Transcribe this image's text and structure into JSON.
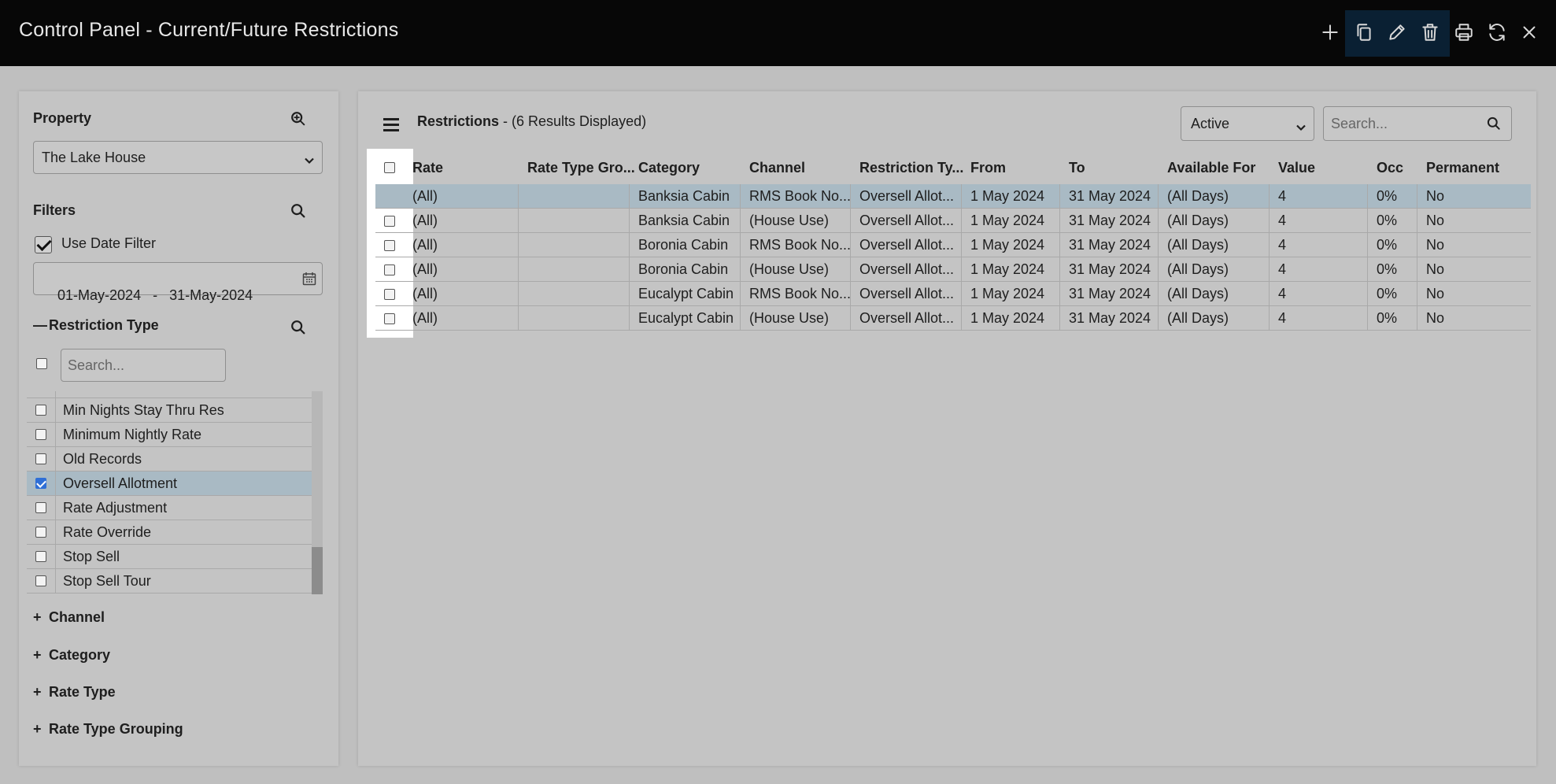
{
  "header": {
    "title": "Control Panel - Current/Future Restrictions",
    "actions": [
      "add-icon",
      "copy-icon",
      "edit-icon",
      "delete-icon",
      "print-icon",
      "refresh-icon",
      "close-icon"
    ]
  },
  "left_panel": {
    "property_label": "Property",
    "property_value": "The Lake House",
    "filters_label": "Filters",
    "use_date_filter_label": "Use Date Filter",
    "use_date_filter_checked": true,
    "date_range": "01-May-2024   -   31-May-2024",
    "restriction_type_label": "Restriction Type",
    "restriction_search_placeholder": "Search...",
    "restriction_items": [
      {
        "label": "Min Nights Stay Thru Res",
        "checked": false
      },
      {
        "label": "Minimum Nightly Rate",
        "checked": false
      },
      {
        "label": "Old Records",
        "checked": false
      },
      {
        "label": "Oversell Allotment",
        "checked": true
      },
      {
        "label": "Rate Adjustment",
        "checked": false
      },
      {
        "label": "Rate Override",
        "checked": false
      },
      {
        "label": "Stop Sell",
        "checked": false
      },
      {
        "label": "Stop Sell Tour",
        "checked": false
      }
    ],
    "collapsed_sections": [
      "Channel",
      "Category",
      "Rate Type",
      "Rate Type Grouping"
    ]
  },
  "main": {
    "title_bold": "Restrictions",
    "title_rest": " - (6 Results Displayed)",
    "status_filter": "Active",
    "search_placeholder": "Search...",
    "columns": [
      "Rate",
      "Rate Type Gro...",
      "Category",
      "Channel",
      "Restriction Ty...",
      "From",
      "To",
      "Available For",
      "Value",
      "Occ",
      "Permanent"
    ],
    "rows": [
      {
        "checked": true,
        "cells": [
          "(All)",
          "",
          "Banksia Cabin",
          "RMS Book No...",
          "Oversell Allot...",
          "1 May 2024",
          "31 May 2024",
          "(All Days)",
          "4",
          "0%",
          "No"
        ]
      },
      {
        "checked": false,
        "cells": [
          "(All)",
          "",
          "Banksia Cabin",
          "(House Use)",
          "Oversell Allot...",
          "1 May 2024",
          "31 May 2024",
          "(All Days)",
          "4",
          "0%",
          "No"
        ]
      },
      {
        "checked": false,
        "cells": [
          "(All)",
          "",
          "Boronia Cabin",
          "RMS Book No...",
          "Oversell Allot...",
          "1 May 2024",
          "31 May 2024",
          "(All Days)",
          "4",
          "0%",
          "No"
        ]
      },
      {
        "checked": false,
        "cells": [
          "(All)",
          "",
          "Boronia Cabin",
          "(House Use)",
          "Oversell Allot...",
          "1 May 2024",
          "31 May 2024",
          "(All Days)",
          "4",
          "0%",
          "No"
        ]
      },
      {
        "checked": false,
        "cells": [
          "(All)",
          "",
          "Eucalypt Cabin",
          "RMS Book No...",
          "Oversell Allot...",
          "1 May 2024",
          "31 May 2024",
          "(All Days)",
          "4",
          "0%",
          "No"
        ]
      },
      {
        "checked": false,
        "cells": [
          "(All)",
          "",
          "Eucalypt Cabin",
          "(House Use)",
          "Oversell Allot...",
          "1 May 2024",
          "31 May 2024",
          "(All Days)",
          "4",
          "0%",
          "No"
        ]
      }
    ]
  }
}
